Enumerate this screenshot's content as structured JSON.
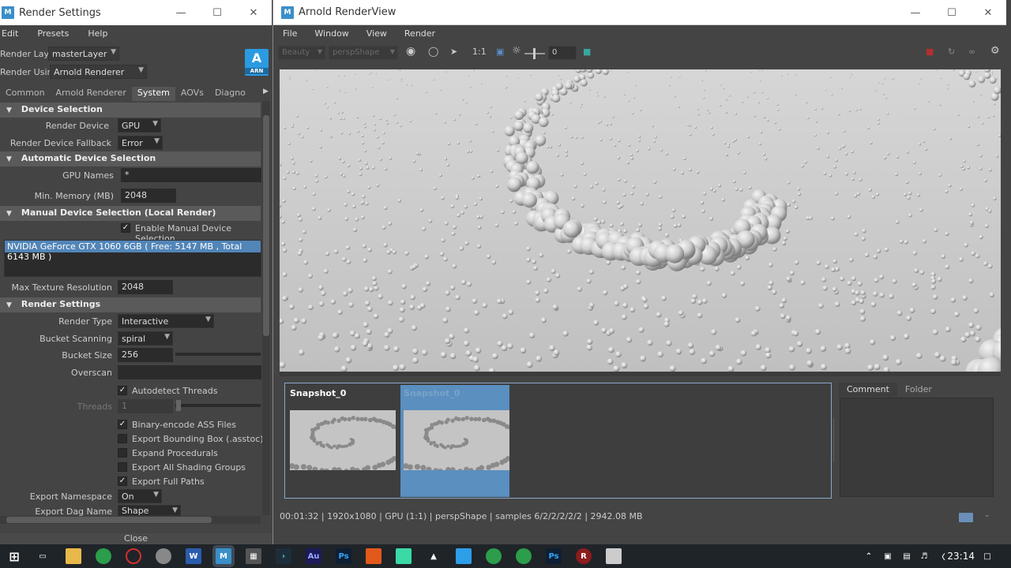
{
  "render_settings": {
    "title": "Render Settings",
    "menu": [
      "Edit",
      "Presets",
      "Help"
    ],
    "render_layer_label": "Render Layer",
    "render_layer_value": "masterLayer",
    "render_using_label": "Render Using",
    "render_using_value": "Arnold Renderer",
    "logo_text": "A",
    "logo_sub": "ARN",
    "tabs": [
      "Common",
      "Arnold Renderer",
      "System",
      "AOVs",
      "Diagno"
    ],
    "active_tab": "System",
    "device_selection": {
      "header": "Device Selection",
      "render_device_label": "Render Device",
      "render_device_value": "GPU",
      "fallback_label": "Render Device Fallback",
      "fallback_value": "Error"
    },
    "auto_device": {
      "header": "Automatic Device Selection",
      "gpu_names_label": "GPU Names",
      "gpu_names_value": "*",
      "min_memory_label": "Min. Memory (MB)",
      "min_memory_value": "2048"
    },
    "manual_device": {
      "header": "Manual Device Selection (Local Render)",
      "enable_label": "Enable Manual Device Selection",
      "gpu_entry": "NVIDIA GeForce GTX 1060 6GB ( Free: 5147 MB , Total 6143 MB )",
      "max_texture_label": "Max Texture Resolution",
      "max_texture_value": "2048"
    },
    "render_settings_section": {
      "header": "Render Settings",
      "render_type_label": "Render Type",
      "render_type_value": "Interactive",
      "bucket_scanning_label": "Bucket Scanning",
      "bucket_scanning_value": "spiral",
      "bucket_size_label": "Bucket Size",
      "bucket_size_value": "256",
      "overscan_label": "Overscan",
      "autodetect_label": "Autodetect Threads",
      "threads_label": "Threads",
      "threads_value": "1",
      "binary_label": "Binary-encode ASS Files",
      "bbox_label": "Export Bounding Box (.asstoc)",
      "expand_label": "Expand Procedurals",
      "shading_label": "Export All Shading Groups",
      "fullpaths_label": "Export Full Paths",
      "namespace_label": "Export Namespace",
      "namespace_value": "On",
      "dag_label": "Export Dag Name",
      "dag_value": "Shape"
    },
    "close_label": "Close"
  },
  "render_view": {
    "title": "Arnold RenderView",
    "menu": [
      "File",
      "Window",
      "View",
      "Render"
    ],
    "toolbar": {
      "aov_value": "Beauty",
      "camera_value": "perspShape",
      "ratio_label": "1:1",
      "exposure_value": "0"
    },
    "snapshots": [
      {
        "name": "Snapshot_0"
      },
      {
        "name": "Snapshot_0"
      }
    ],
    "side_tabs": [
      "Comment",
      "Folder"
    ],
    "status_text": "00:01:32 | 1920x1080 | GPU (1:1) | perspShape | samples 6/2/2/2/2/2 | 2942.08 MB"
  },
  "taskbar": {
    "time": "23:14"
  }
}
